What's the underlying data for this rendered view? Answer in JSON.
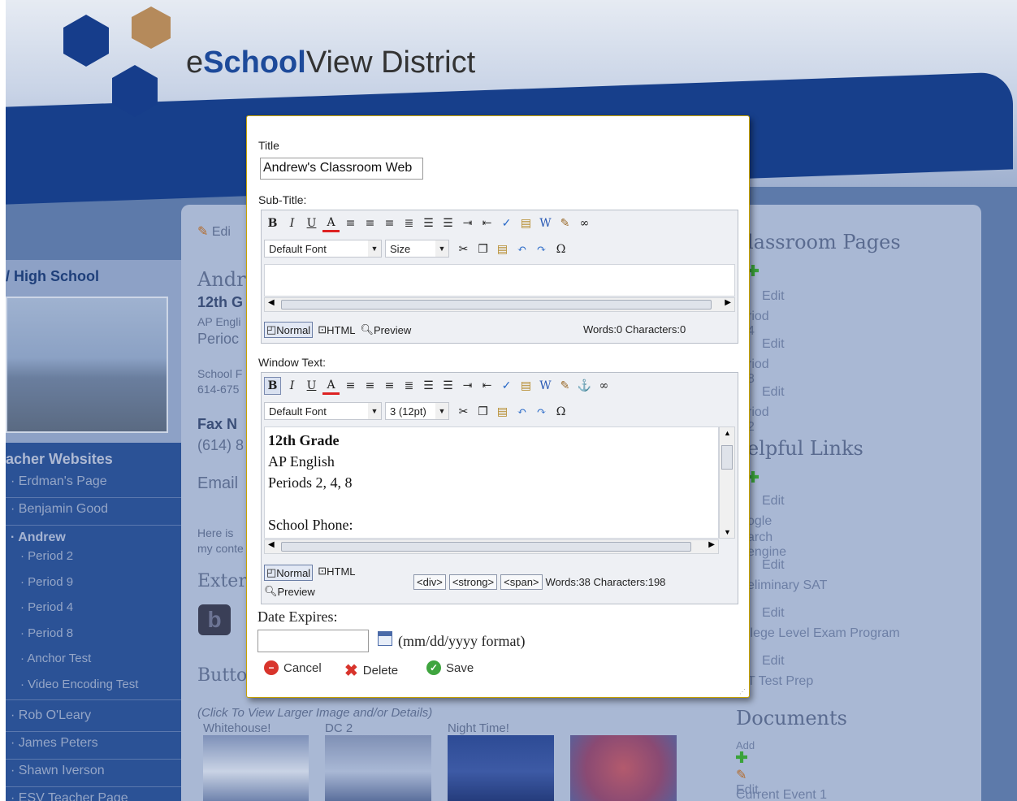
{
  "site": {
    "logo_prefix": "e",
    "logo_bold": "School",
    "logo_rest": "View District",
    "school_name": "/ High School",
    "edit_label": "Edi",
    "accent_color": "#1d4a9a"
  },
  "main": {
    "heading_partial": "Andr",
    "grade_partial": "12th G",
    "ap_partial": "AP Engli",
    "period_partial": "Perioc",
    "school_p": "School F",
    "phone_p": "614-675",
    "fax": "Fax N",
    "fax_num": "(614) 8",
    "email": "Email",
    "here_is": "Here is",
    "my_cont": "my conte",
    "external": "Exter",
    "buttons": "Butto",
    "gallery_caption": "(Click To View Larger Image and/or Details)",
    "gallery": [
      "Whitehouse!",
      "DC 2",
      "Night Time!"
    ]
  },
  "nav": {
    "title": "acher Websites",
    "items": [
      "Erdman's Page",
      "Benjamin Good",
      "Andrew"
    ],
    "sub": [
      "Period 2",
      "Period 9",
      "Period 4",
      "Period 8",
      "Anchor Test",
      "Video Encoding Test"
    ],
    "more": [
      "Rob O'Leary",
      "James Peters",
      "Shawn Iverson",
      "ESV Teacher Page"
    ]
  },
  "right": {
    "classroom_pages": "lassroom Pages",
    "edit": "Edit",
    "pages": [
      "riod 4",
      "riod 8",
      "riod 2"
    ],
    "helpful_links": "elpful Links",
    "links": [
      "ogle",
      "arch engine",
      "eliminary SAT",
      "llege Level Exam Program",
      "T Test Prep"
    ],
    "documents": "Documents",
    "add": "Add",
    "current_event": "Current Event 1"
  },
  "dialog": {
    "title_label": "Title",
    "title_value": "Andrew's Classroom Web",
    "subtitle_label": "Sub-Title:",
    "window_text_label": "Window Text:",
    "font_select": "Default Font",
    "size_select": "Size",
    "size_select2": "3 (12pt)",
    "mode_normal": "Normal",
    "mode_html": "HTML",
    "mode_preview": "Preview",
    "sub_stats": "Words:0 Characters:0",
    "win_stats": "Words:38 Characters:198",
    "tags": [
      "<div>",
      "<strong>",
      "<span>"
    ],
    "content_lines": [
      "12th Grade",
      "AP English",
      "Periods 2, 4, 8",
      "",
      "School Phone:"
    ],
    "date_label": "Date Expires:",
    "date_value": "",
    "date_format": "(mm/dd/yyyy format)",
    "cancel": "Cancel",
    "delete": "Delete",
    "save": "Save"
  }
}
